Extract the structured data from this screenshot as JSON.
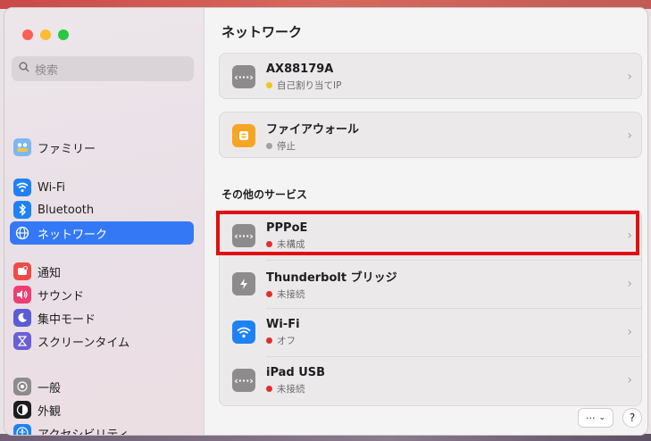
{
  "window": {
    "title": "ネットワーク"
  },
  "sidebar": {
    "search_placeholder": "検索",
    "items": [
      {
        "label": "ファミリー",
        "icon": "family-icon",
        "color": "#7db7f2"
      },
      {
        "label": "Wi-Fi",
        "icon": "wifi-icon",
        "color": "#1e82f5"
      },
      {
        "label": "Bluetooth",
        "icon": "bluetooth-icon",
        "color": "#1e82f5"
      },
      {
        "label": "ネットワーク",
        "icon": "globe-icon",
        "color": "#1e82f5",
        "active": true
      },
      {
        "label": "通知",
        "icon": "bell-icon",
        "color": "#ef4b47"
      },
      {
        "label": "サウンド",
        "icon": "speaker-icon",
        "color": "#ee3e74"
      },
      {
        "label": "集中モード",
        "icon": "moon-icon",
        "color": "#5b5bd6"
      },
      {
        "label": "スクリーンタイム",
        "icon": "hourglass-icon",
        "color": "#6b5fd3"
      },
      {
        "label": "一般",
        "icon": "gear-icon",
        "color": "#8d8b8c"
      },
      {
        "label": "外観",
        "icon": "appearance-icon",
        "color": "#1d1d1f"
      },
      {
        "label": "アクセシビリティ",
        "icon": "accessibility-icon",
        "color": "#1e82f5"
      }
    ]
  },
  "main": {
    "top_services": [
      {
        "name": "AX88179A",
        "status": "自己割り当てIP",
        "status_color": "#f5c223",
        "icon": "ethernet-icon"
      },
      {
        "name": "ファイアウォール",
        "status": "停止",
        "status_color": "#a3a1a2",
        "icon": "firewall-icon"
      }
    ],
    "section_title": "その他のサービス",
    "other_services": [
      {
        "name": "PPPoE",
        "status": "未構成",
        "status_color": "#e0302d",
        "icon": "ethernet-icon"
      },
      {
        "name": "Thunderbolt ブリッジ",
        "status": "未接続",
        "status_color": "#e0302d",
        "icon": "thunderbolt-icon"
      },
      {
        "name": "Wi-Fi",
        "status": "オフ",
        "status_color": "#e0302d",
        "icon": "wifi-icon"
      },
      {
        "name": "iPad USB",
        "status": "未接続",
        "status_color": "#e0302d",
        "icon": "ethernet-icon"
      }
    ],
    "more_button_label": "···",
    "help_button_label": "?"
  },
  "accent": "#e00f12"
}
